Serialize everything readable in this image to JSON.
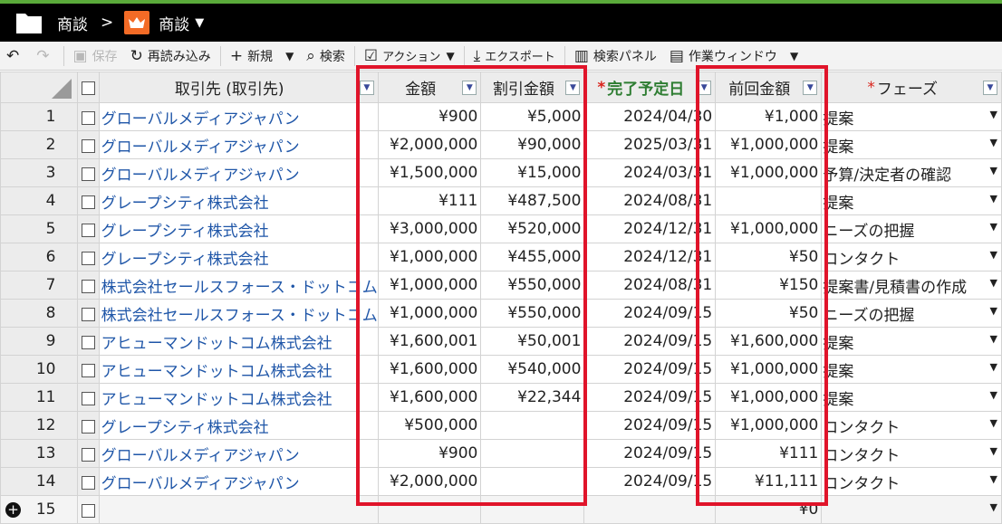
{
  "titlebar": {
    "breadcrumb": "商談",
    "separator": ">",
    "object_label": "商談",
    "caret": "▼"
  },
  "toolbar": {
    "undo": "↶",
    "redo": "↷",
    "save": "保存",
    "reload": "再読み込み",
    "new": "新規",
    "search": "検索",
    "action": "アクション",
    "export": "エクスポート",
    "search_panel": "検索パネル",
    "work_window": "作業ウィンドウ",
    "caret": "▼"
  },
  "columns": {
    "account": "取引先 (取引先)",
    "amount": "金額",
    "discount": "割引金額",
    "close_date": "完了予定日",
    "prev_amount": "前回金額",
    "phase": "フェーズ",
    "required_mark": "*"
  },
  "rows": [
    {
      "n": "1",
      "account": "グローバルメディアジャパン",
      "amount": "¥900",
      "discount": "¥5,000",
      "date": "2024/04/30",
      "prev": "¥1,000",
      "phase": "提案"
    },
    {
      "n": "2",
      "account": "グローバルメディアジャパン",
      "amount": "¥2,000,000",
      "discount": "¥90,000",
      "date": "2025/03/31",
      "prev": "¥1,000,000",
      "phase": "提案"
    },
    {
      "n": "3",
      "account": "グローバルメディアジャパン",
      "amount": "¥1,500,000",
      "discount": "¥15,000",
      "date": "2024/03/31",
      "prev": "¥1,000,000",
      "phase": "予算/決定者の確認"
    },
    {
      "n": "4",
      "account": "グレープシティ株式会社",
      "amount": "¥111",
      "discount": "¥487,500",
      "date": "2024/08/31",
      "prev": "",
      "phase": "提案"
    },
    {
      "n": "5",
      "account": "グレープシティ株式会社",
      "amount": "¥3,000,000",
      "discount": "¥520,000",
      "date": "2024/12/31",
      "prev": "¥1,000,000",
      "phase": "ニーズの把握"
    },
    {
      "n": "6",
      "account": "グレープシティ株式会社",
      "amount": "¥1,000,000",
      "discount": "¥455,000",
      "date": "2024/12/31",
      "prev": "¥50",
      "phase": "コンタクト"
    },
    {
      "n": "7",
      "account": "株式会社セールスフォース・ドットコム",
      "amount": "¥1,000,000",
      "discount": "¥550,000",
      "date": "2024/08/31",
      "prev": "¥150",
      "phase": "提案書/見積書の作成"
    },
    {
      "n": "8",
      "account": "株式会社セールスフォース・ドットコム",
      "amount": "¥1,000,000",
      "discount": "¥550,000",
      "date": "2024/09/15",
      "prev": "¥50",
      "phase": "ニーズの把握"
    },
    {
      "n": "9",
      "account": "アヒューマンドットコム株式会社",
      "amount": "¥1,600,001",
      "discount": "¥50,001",
      "date": "2024/09/15",
      "prev": "¥1,600,000",
      "phase": "提案"
    },
    {
      "n": "10",
      "account": "アヒューマンドットコム株式会社",
      "amount": "¥1,600,000",
      "discount": "¥540,000",
      "date": "2024/09/15",
      "prev": "¥1,000,000",
      "phase": "提案"
    },
    {
      "n": "11",
      "account": "アヒューマンドットコム株式会社",
      "amount": "¥1,600,000",
      "discount": "¥22,344",
      "date": "2024/09/15",
      "prev": "¥1,000,000",
      "phase": "提案"
    },
    {
      "n": "12",
      "account": "グレープシティ株式会社",
      "amount": "¥500,000",
      "discount": "",
      "date": "2024/09/15",
      "prev": "¥1,000,000",
      "phase": "コンタクト"
    },
    {
      "n": "13",
      "account": "グローバルメディアジャパン",
      "amount": "¥900",
      "discount": "",
      "date": "2024/09/15",
      "prev": "¥111",
      "phase": "コンタクト"
    },
    {
      "n": "14",
      "account": "グローバルメディアジャパン",
      "amount": "¥2,000,000",
      "discount": "",
      "date": "2024/09/15",
      "prev": "¥11,111",
      "phase": "コンタクト"
    }
  ],
  "new_row": {
    "n": "15",
    "prev": "¥0",
    "add_icon": "+"
  },
  "highlight_color": "#e0142a",
  "accent_color": "#f36b26"
}
